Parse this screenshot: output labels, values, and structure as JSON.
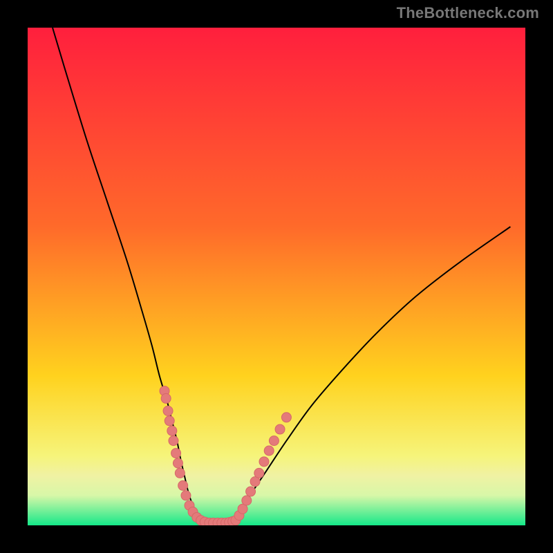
{
  "watermark": "TheBottleneck.com",
  "colors": {
    "frame": "#000000",
    "top": "#ff1f3d",
    "mid1": "#ff6a2a",
    "mid2": "#ffd21e",
    "lower": "#f6f47a",
    "band_top": "#f0f2a3",
    "band_bottom": "#d8f7a8",
    "base": "#15e889",
    "curve": "#000000",
    "marker_fill": "#e47a7a",
    "marker_stroke": "#d56868"
  },
  "chart_data": {
    "type": "line",
    "title": "",
    "xlabel": "",
    "ylabel": "",
    "xlim": [
      0,
      100
    ],
    "ylim": [
      0,
      100
    ],
    "series": [
      {
        "name": "left-branch",
        "x": [
          5,
          8,
          12,
          16,
          20,
          23,
          25,
          26.5,
          28,
          29,
          30,
          30.8,
          31.5,
          32.2,
          33,
          34,
          35
        ],
        "y": [
          100,
          90,
          77,
          65,
          53,
          43,
          36,
          30,
          25,
          21,
          17,
          13,
          10,
          7,
          4.5,
          2.5,
          1
        ]
      },
      {
        "name": "valley-floor",
        "x": [
          35,
          36,
          37,
          38,
          39,
          40,
          41,
          41.8
        ],
        "y": [
          1,
          0.6,
          0.5,
          0.5,
          0.5,
          0.5,
          0.7,
          1
        ]
      },
      {
        "name": "right-branch",
        "x": [
          41.8,
          43,
          45,
          48,
          52,
          57,
          63,
          70,
          78,
          87,
          97
        ],
        "y": [
          1,
          3,
          6.5,
          11,
          17,
          24,
          31,
          38.5,
          46,
          53,
          60
        ]
      }
    ],
    "markers": {
      "name": "marker-cluster",
      "points": [
        [
          27.5,
          27
        ],
        [
          27.8,
          25.5
        ],
        [
          28.2,
          23
        ],
        [
          28.5,
          21
        ],
        [
          29,
          19
        ],
        [
          29.3,
          17
        ],
        [
          29.8,
          14.5
        ],
        [
          30.2,
          12.5
        ],
        [
          30.6,
          10.5
        ],
        [
          31.2,
          8
        ],
        [
          31.8,
          6
        ],
        [
          32.5,
          4
        ],
        [
          33.2,
          2.7
        ],
        [
          34,
          1.6
        ],
        [
          34.8,
          1
        ],
        [
          35.6,
          0.7
        ],
        [
          36.5,
          0.5
        ],
        [
          37.3,
          0.5
        ],
        [
          38.2,
          0.5
        ],
        [
          39,
          0.5
        ],
        [
          39.8,
          0.5
        ],
        [
          40.5,
          0.6
        ],
        [
          41.2,
          0.8
        ],
        [
          41.8,
          1
        ],
        [
          42.5,
          2
        ],
        [
          43.2,
          3.3
        ],
        [
          44,
          5
        ],
        [
          44.8,
          6.8
        ],
        [
          45.7,
          8.8
        ],
        [
          46.5,
          10.5
        ],
        [
          47.5,
          12.8
        ],
        [
          48.5,
          15
        ],
        [
          49.5,
          17
        ],
        [
          50.7,
          19.3
        ],
        [
          52,
          21.7
        ]
      ]
    },
    "gradient_bands": [
      {
        "y": 100,
        "color_key": "top"
      },
      {
        "y": 60,
        "color_key": "mid1"
      },
      {
        "y": 30,
        "color_key": "mid2"
      },
      {
        "y": 14,
        "color_key": "lower"
      },
      {
        "y": 10,
        "color_key": "band_top"
      },
      {
        "y": 6,
        "color_key": "band_bottom"
      },
      {
        "y": 0,
        "color_key": "base"
      }
    ]
  }
}
